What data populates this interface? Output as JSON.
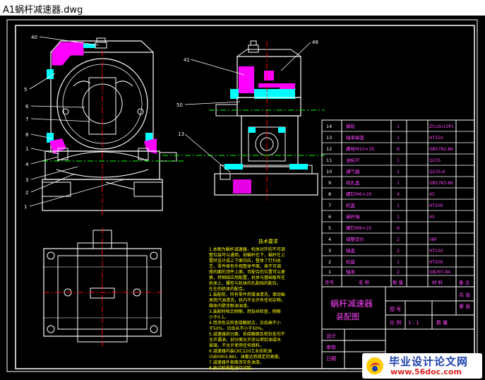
{
  "window": {
    "title": "A1蜗杆减速器.dwg"
  },
  "colors": {
    "background": "#000000",
    "line": "#ffffff",
    "accent": "#ff00ff",
    "cyan": "#00ffff",
    "yellow": "#ffff00",
    "green": "#00ff00",
    "blue": "#0000ff",
    "magenta_text": "#ff44ff"
  },
  "leaders": {
    "front": [
      "40",
      "5",
      "6",
      "7",
      "8",
      "1",
      "4",
      "3",
      "2",
      "1"
    ],
    "side": [
      "41",
      "48",
      "50",
      "13"
    ]
  },
  "notes": {
    "heading": "技术要求",
    "lines": [
      "1.本图为蜗杆减速器，机体对开的不可调",
      "   整位装可以通用，如蜗杆在下，蜗杆在上",
      "   置时设计成上下面均应，整体了打扫总",
      "   艺，零件原有外观整体平面，表不可调",
      "   修的面的顶件上面，可配合的位置可以更",
      "   换，将相结应用配置，机体与基础板有在",
      "   机体上，螺栓与机体的孔配结的配合。",
      "   在在的机体的配合。",
      "2.装配前，所有零件用煤油清洗，滚动轴",
      "   承用汽油清洗，机内不允许有任何杂物，",
      "   箱体内壁涂耐油油漆。",
      "3.装配时啮合侧隙，用铅丝检查，侧隙",
      "   小于0.1。",
      "4.用涂色法检查接触斑点，沿齿高不小",
      "   于50%，沿齿长不小于50%。",
      "5.减速器剖分面、各接触面及密封处均不",
      "   允许漏油，剖分面允许涂以密封油或水",
      "   玻璃，不允许使用任何填料。",
      "6.减速器内装CKC220工业齿轮油",
      "   (GB5903-86)，油量达到规定的高度。",
      "7.减速器外表面涂灰色油漆。",
      "8.按试验规程进行试验。"
    ]
  },
  "parts_list": {
    "rows": [
      {
        "no": "14",
        "name": "蜗轮",
        "qty": "1",
        "mat": "ZCuSn10P1"
      },
      {
        "no": "13",
        "name": "轴承端盖",
        "qty": "1",
        "mat": "HT150"
      },
      {
        "no": "12",
        "name": "螺栓M10×35",
        "qty": "6",
        "mat": "GB5782-86"
      },
      {
        "no": "11",
        "name": "油标尺",
        "qty": "1",
        "mat": "Q235"
      },
      {
        "no": "10",
        "name": "通气器",
        "qty": "1",
        "mat": "Q235-A"
      },
      {
        "no": "9",
        "name": "视孔盖",
        "qty": "1",
        "mat": "GB5783-86"
      },
      {
        "no": "8",
        "name": "螺钉M6×20",
        "qty": "4",
        "mat": "45"
      },
      {
        "no": "7",
        "name": "机盖",
        "qty": "1",
        "mat": "HT200"
      },
      {
        "no": "6",
        "name": "蜗杆轴",
        "qty": "1",
        "mat": "45"
      },
      {
        "no": "5",
        "name": "螺钉M8×25",
        "qty": "6",
        "mat": ""
      },
      {
        "no": "4",
        "name": "调整垫片",
        "qty": "2",
        "mat": "08F"
      },
      {
        "no": "3",
        "name": "端盖",
        "qty": "2",
        "mat": "HT150"
      },
      {
        "no": "2",
        "name": "机座",
        "qty": "1",
        "mat": "HT200"
      },
      {
        "no": "1",
        "name": "轴承",
        "qty": "2",
        "mat": "GB297-84"
      }
    ],
    "header": {
      "no": "序号",
      "name": "名 称",
      "qty": "数 量",
      "mat": "材 料",
      "note": "备 注"
    }
  },
  "title_block": {
    "drawing_name_1": "蜗杆减速器",
    "drawing_name_2": "装配图",
    "tuhao_label": "图 号",
    "scale_label": "比 例",
    "scale_value": "1 : 1",
    "qty_label": "数 量",
    "weight_label": "重 量",
    "material_label": "共 张",
    "sheet_label": "第 张",
    "design_label": "设计",
    "check_label": "审核",
    "approve_label": "日期"
  },
  "watermark": {
    "title": "毕业设计论文网",
    "url": "www.56doc.com"
  }
}
